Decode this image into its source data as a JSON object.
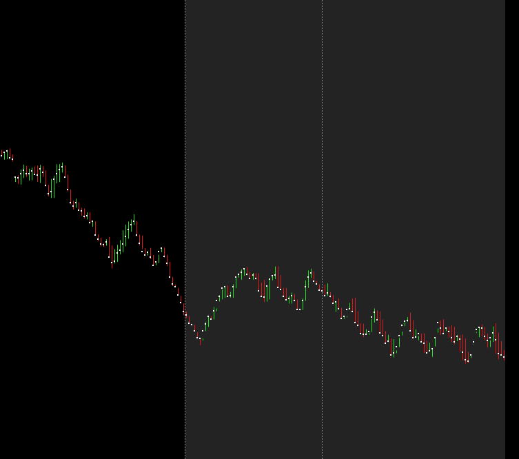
{
  "colors": {
    "background": "#000000",
    "session_shade": "#232323",
    "separator": "#8a8a8a",
    "bull": "#20e020",
    "bear": "#e01818",
    "tick": "#ffffff",
    "right_gutter": "#000000"
  },
  "chart_data": {
    "type": "ohlc",
    "title": "",
    "xlabel": "",
    "ylabel": "",
    "grid": false,
    "legend": "none",
    "x": [
      1,
      2,
      3,
      4,
      5,
      6,
      7,
      8,
      9,
      10,
      11,
      12,
      13,
      14,
      15,
      16,
      17,
      18,
      19,
      20,
      21,
      22,
      23,
      24,
      25,
      26,
      27,
      28,
      29,
      30,
      31,
      32,
      33,
      34,
      35,
      36,
      37,
      38,
      39,
      40,
      41,
      42,
      43,
      44,
      45,
      46,
      47,
      48,
      49,
      50,
      51,
      52,
      53,
      54,
      55,
      56,
      57,
      58,
      59,
      60,
      61,
      62,
      63,
      64,
      65,
      66,
      67,
      68,
      69,
      70,
      71,
      72,
      73,
      74,
      75,
      76,
      77,
      78,
      79,
      80,
      81,
      82,
      83,
      84,
      85,
      86,
      87,
      88,
      89,
      90,
      91,
      92,
      93,
      94,
      95,
      96,
      97,
      98,
      99,
      100,
      101,
      102,
      103,
      104,
      105,
      106,
      107,
      108,
      109,
      110,
      111,
      112,
      113,
      114,
      115,
      116,
      117,
      118,
      119,
      120,
      121,
      122,
      123,
      124,
      125,
      126,
      127,
      128,
      129,
      130,
      131,
      132,
      133,
      134,
      135,
      136,
      137,
      138,
      139,
      140,
      141,
      142,
      143,
      144,
      145,
      146,
      147,
      148,
      149,
      150,
      151,
      152,
      153,
      154,
      155,
      156,
      157,
      158,
      159,
      160,
      161,
      162,
      163,
      164,
      165,
      166,
      167,
      168,
      169,
      170,
      171,
      172,
      173,
      174,
      175,
      176,
      177,
      178,
      179,
      180,
      181,
      182,
      183
    ],
    "open": [
      40.0,
      39.1,
      40.2,
      40.6,
      38.5,
      31.6,
      32.2,
      31.8,
      33.3,
      34.4,
      33.2,
      33.2,
      34.2,
      33.0,
      32.7,
      34.8,
      33.7,
      29.4,
      26.6,
      27.3,
      31.5,
      33.3,
      34.6,
      35.6,
      32.2,
      28.1,
      23.8,
      22.6,
      23.7,
      21.4,
      21.0,
      19.3,
      19.6,
      17.2,
      17.7,
      13.2,
      11.8,
      10.3,
      10.1,
      11.0,
      5.9,
      4.1,
      4.7,
      7.3,
      8.3,
      10.2,
      12.7,
      15.0,
      16.6,
      17.6,
      13.1,
      10.6,
      7.7,
      6.7,
      7.6,
      5.9,
      3.4,
      4.4,
      7.7,
      9.0,
      6.3,
      3.9,
      -0.6,
      -2.9,
      -3.6,
      -6.4,
      -8.8,
      -11.8,
      -12.9,
      -15.6,
      -16.0,
      -18.0,
      -20.4,
      -20.5,
      -18.2,
      -15.9,
      -13.4,
      -14.2,
      -11.5,
      -8.3,
      -6.8,
      -4.1,
      -3.6,
      -6.9,
      -6.6,
      -3.7,
      -0.6,
      0.4,
      1.1,
      2.1,
      0.4,
      -1.0,
      0.1,
      -1.1,
      -5.0,
      -6.9,
      -7.1,
      -3.4,
      -1.3,
      -0.1,
      0.2,
      -3.9,
      -4.6,
      -6.9,
      -8.0,
      -7.6,
      -6.7,
      -8.3,
      -11.2,
      -11.1,
      -8.1,
      -3.6,
      -0.6,
      0.7,
      -1.8,
      -2.9,
      -4.8,
      -5.1,
      -6.7,
      -5.7,
      -6.9,
      -9.0,
      -8.6,
      -11.0,
      -14.0,
      -13.4,
      -11.1,
      -10.8,
      -11.7,
      -15.5,
      -16.3,
      -19.0,
      -19.3,
      -19.2,
      -18.4,
      -13.6,
      -12.1,
      -14.4,
      -18.8,
      -19.7,
      -22.2,
      -21.4,
      -26.1,
      -25.3,
      -23.4,
      -19.6,
      -16.2,
      -14.9,
      -14.7,
      -18.2,
      -20.3,
      -20.1,
      -19.1,
      -21.8,
      -22.1,
      -25.3,
      -24.6,
      -24.0,
      -20.3,
      -15.5,
      -17.3,
      -19.1,
      -17.1,
      -18.3,
      -20.3,
      -21.8,
      -19.9,
      -20.8,
      -25.0,
      -27.6,
      -28.0,
      -26.0,
      -21.6,
      -17.7,
      -17.0,
      -17.1,
      -20.0,
      -21.2,
      -20.3,
      -18.7,
      -21.1,
      -25.6,
      -26.1,
      -26.6,
      -27.1,
      -28.8,
      -30.6,
      -29.3,
      -29.6
    ],
    "high": [
      41.0,
      40.3,
      41.0,
      41.5,
      39.5,
      31.9,
      32.7,
      34.6,
      36.2,
      35.8,
      34.9,
      35.2,
      35.6,
      35.9,
      36.1,
      35.7,
      34.3,
      29.6,
      31.5,
      32.5,
      36.3,
      36.4,
      36.9,
      35.9,
      32.9,
      28.1,
      24.4,
      25.1,
      23.9,
      22.1,
      21.8,
      20.6,
      20.6,
      17.7,
      17.7,
      13.4,
      12.3,
      10.6,
      11.8,
      12.6,
      9.8,
      8.6,
      10.0,
      11.5,
      14.8,
      16.6,
      17.6,
      18.3,
      20.0,
      17.7,
      13.3,
      13.0,
      8.9,
      7.9,
      9.0,
      6.7,
      4.1,
      6.8,
      9.0,
      9.1,
      6.7,
      4.4,
      -0.5,
      -3.0,
      -4.1,
      -6.7,
      -9.2,
      -11.8,
      -13.3,
      -15.8,
      -16.2,
      -18.6,
      -20.5,
      -20.6,
      -15.3,
      -13.6,
      -13.3,
      -10.3,
      -10.8,
      -6.5,
      -4.6,
      -3.6,
      -3.3,
      -5.4,
      -2.9,
      -0.8,
      0.6,
      1.9,
      2.2,
      2.7,
      1.1,
      0.8,
      0.7,
      0.7,
      -2.4,
      -1.5,
      -3.3,
      -1.5,
      -0.3,
      2.9,
      3.0,
      0.1,
      -4.1,
      -4.1,
      -6.8,
      -5.6,
      -6.1,
      -7.9,
      -11.0,
      -7.5,
      -1.6,
      1.6,
      2.2,
      1.3,
      -1.8,
      -2.9,
      -4.3,
      -3.0,
      -2.6,
      -5.5,
      -6.4,
      -8.4,
      -7.5,
      -10.6,
      -13.7,
      -13.3,
      -9.0,
      -7.6,
      -7.3,
      -11.7,
      -15.7,
      -15.8,
      -17.6,
      -18.8,
      -14.2,
      -10.8,
      -11.4,
      -11.8,
      -14.4,
      -18.2,
      -19.4,
      -20.6,
      -20.8,
      -24.5,
      -20.4,
      -18.4,
      -15.3,
      -13.6,
      -12.2,
      -14.6,
      -17.6,
      -19.8,
      -19.0,
      -18.9,
      -21.3,
      -22.0,
      -23.7,
      -23.2,
      -18.7,
      -14.8,
      -14.3,
      -17.1,
      -16.7,
      -16.3,
      -16.8,
      -19.5,
      -19.5,
      -19.3,
      -20.6,
      -25.0,
      -27.0,
      -22.5,
      -18.5,
      -17.0,
      -16.0,
      -16.9,
      -19.0,
      -21.2,
      -16.7,
      -15.6,
      -18.7,
      -21.5,
      -24.4,
      -25.1,
      -27.1,
      -27.9,
      -28.0,
      -28.3
    ],
    "low": [
      39.0,
      37.8,
      38.0,
      38.1,
      37.2,
      30.5,
      29.9,
      29.7,
      31.8,
      32.2,
      31.0,
      31.1,
      33.1,
      30.5,
      30.2,
      32.2,
      29.0,
      25.8,
      25.3,
      25.3,
      30.1,
      30.5,
      33.6,
      32.1,
      27.5,
      23.2,
      21.5,
      22.1,
      21.1,
      19.5,
      18.6,
      18.3,
      16.9,
      15.9,
      13.0,
      11.2,
      9.5,
      9.3,
      9.7,
      5.9,
      2.3,
      3.9,
      4.4,
      6.9,
      7.6,
      9.5,
      12.0,
      14.3,
      16.5,
      12.7,
      9.9,
      8.6,
      6.3,
      6.5,
      5.3,
      3.4,
      3.3,
      4.0,
      7.6,
      5.8,
      3.0,
      -0.9,
      -3.5,
      -3.5,
      -6.5,
      -9.3,
      -13.0,
      -14.0,
      -15.9,
      -16.4,
      -18.3,
      -20.5,
      -22.8,
      -21.3,
      -18.2,
      -16.8,
      -14.0,
      -14.4,
      -11.7,
      -8.5,
      -7.8,
      -7.3,
      -7.1,
      -7.2,
      -7.3,
      -4.2,
      -0.7,
      -1.4,
      -0.1,
      0.0,
      -1.2,
      -1.4,
      -1.4,
      -5.1,
      -7.0,
      -8.7,
      -8.6,
      -7.8,
      -1.6,
      -1.2,
      -3.8,
      -4.8,
      -6.9,
      -8.1,
      -9.2,
      -9.2,
      -8.4,
      -11.2,
      -11.4,
      -11.3,
      -8.3,
      -4.1,
      -0.8,
      -1.7,
      -3.0,
      -4.8,
      -5.1,
      -6.8,
      -6.7,
      -7.2,
      -9.0,
      -11.9,
      -10.9,
      -14.3,
      -14.2,
      -13.7,
      -11.1,
      -11.6,
      -15.2,
      -16.3,
      -19.0,
      -20.2,
      -19.4,
      -19.4,
      -18.5,
      -15.4,
      -14.6,
      -18.6,
      -19.9,
      -22.1,
      -21.8,
      -26.3,
      -26.8,
      -25.4,
      -23.4,
      -19.6,
      -16.6,
      -15.2,
      -18.2,
      -20.2,
      -20.1,
      -21.2,
      -21.8,
      -25.3,
      -25.5,
      -24.7,
      -26.6,
      -20.4,
      -17.3,
      -19.4,
      -19.2,
      -18.2,
      -20.3,
      -21.8,
      -22.5,
      -21.5,
      -25.0,
      -27.7,
      -28.9,
      -28.7,
      -25.9,
      -22.6,
      -18.8,
      -20.2,
      -20.0,
      -21.2,
      -23.6,
      -23.4,
      -21.7,
      -25.6,
      -27.4,
      -26.2,
      -27.8,
      -28.9,
      -30.9,
      -31.9,
      -34.8,
      -30.1
    ],
    "close": [
      39.1,
      40.2,
      40.6,
      38.5,
      38.0,
      32.2,
      31.8,
      33.3,
      34.4,
      33.2,
      33.2,
      34.2,
      33.0,
      32.7,
      34.8,
      33.7,
      29.4,
      26.6,
      27.3,
      31.5,
      33.3,
      34.6,
      35.6,
      32.2,
      28.1,
      23.8,
      22.6,
      23.7,
      21.4,
      21.0,
      19.3,
      19.6,
      17.2,
      17.7,
      13.2,
      11.8,
      10.3,
      10.1,
      11.0,
      5.9,
      4.1,
      4.7,
      7.3,
      8.3,
      10.2,
      12.7,
      15.0,
      16.6,
      17.6,
      13.1,
      10.6,
      7.7,
      6.7,
      7.6,
      5.9,
      3.4,
      4.4,
      7.7,
      9.0,
      6.3,
      3.9,
      -0.6,
      -2.9,
      -3.6,
      -6.4,
      -8.8,
      -11.8,
      -12.9,
      -15.6,
      -16.0,
      -18.0,
      -20.4,
      -20.5,
      -18.2,
      -15.9,
      -13.4,
      -14.2,
      -11.5,
      -8.3,
      -6.8,
      -4.1,
      -3.6,
      -6.9,
      -6.6,
      -3.7,
      -0.6,
      0.4,
      1.1,
      2.1,
      0.4,
      -1.0,
      0.1,
      -1.1,
      -5.0,
      -6.9,
      -7.1,
      -3.4,
      -1.3,
      -0.1,
      0.2,
      -3.9,
      -4.6,
      -6.9,
      -8.0,
      -7.6,
      -6.7,
      -8.3,
      -11.2,
      -11.1,
      -8.1,
      -3.6,
      -0.6,
      0.7,
      -1.8,
      -2.9,
      -4.8,
      -5.1,
      -6.7,
      -5.7,
      -6.9,
      -9.0,
      -8.6,
      -11.0,
      -14.0,
      -13.4,
      -11.1,
      -10.8,
      -11.7,
      -15.5,
      -16.3,
      -19.0,
      -19.3,
      -19.2,
      -18.4,
      -13.6,
      -12.1,
      -14.4,
      -18.8,
      -19.7,
      -22.2,
      -21.4,
      -26.1,
      -25.3,
      -23.4,
      -19.6,
      -16.2,
      -14.9,
      -14.7,
      -18.2,
      -20.3,
      -20.1,
      -19.1,
      -21.8,
      -22.1,
      -25.3,
      -24.6,
      -24.0,
      -20.3,
      -15.5,
      -17.3,
      -19.1,
      -17.1,
      -18.3,
      -20.3,
      -21.8,
      -19.9,
      -20.8,
      -25.0,
      -27.6,
      -28.0,
      -26.0,
      -21.6,
      -17.7,
      -17.0,
      -17.1,
      -20.0,
      -21.2,
      -20.3,
      -18.7,
      -21.1,
      -25.6,
      -26.1,
      -26.6,
      -27.1,
      -28.8,
      -30.6,
      -29.3,
      -29.6,
      -29.0
    ],
    "xlim": [
      0.5,
      183.5
    ],
    "ylim": [
      -60,
      90
    ],
    "sessions": [
      {
        "name": "session-1",
        "start": 0.5,
        "end": 67.5,
        "shaded": false
      },
      {
        "name": "session-2",
        "start": 67.5,
        "end": 183.5,
        "shaded": true
      }
    ],
    "separators": [
      67.5,
      117.0
    ]
  }
}
